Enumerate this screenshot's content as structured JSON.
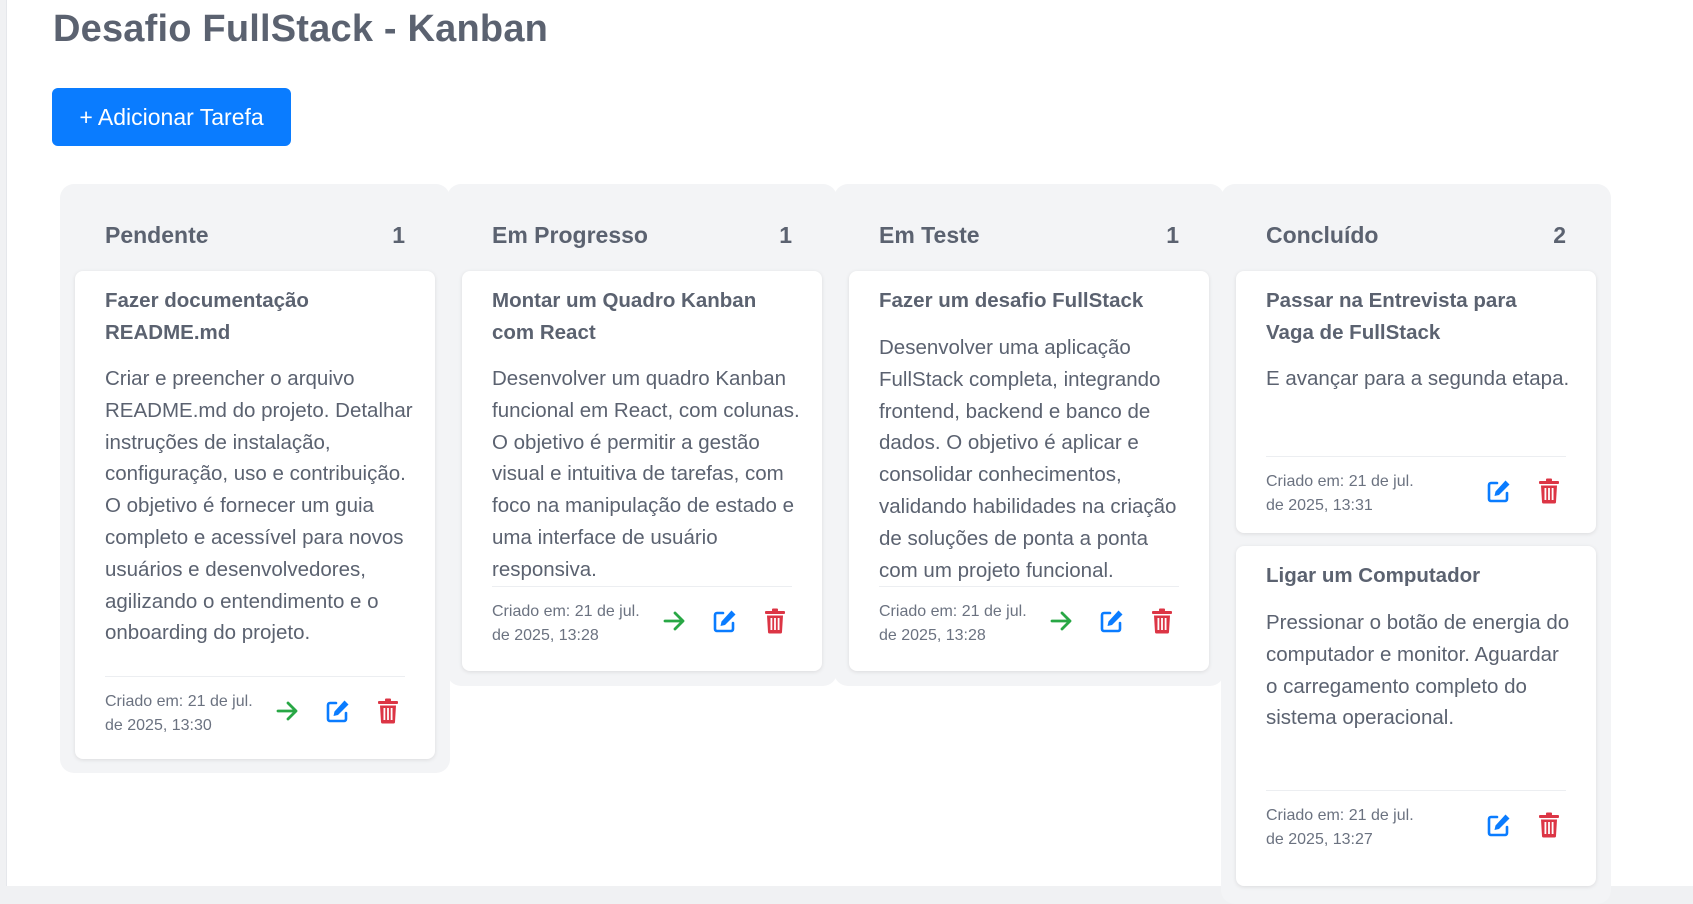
{
  "header": {
    "title": "Desafio FullStack - Kanban",
    "add_button_label": "+ Adicionar Tarefa"
  },
  "colors": {
    "primary": "#0a7cff",
    "move": "#28a745",
    "edit": "#0a7cff",
    "delete": "#dc3545"
  },
  "columns": [
    {
      "title": "Pendente",
      "count": "1",
      "cards": [
        {
          "title": "Fazer documentação README.md",
          "description": "Criar e preencher o arquivo README.md do projeto. Detalhar instruções de instalação, configuração, uso e contribuição. O objetivo é fornecer um guia completo e acessível para novos usuários e desenvolvedores, agilizando o entendimento e o onboarding do projeto.",
          "created": "Criado em: 21 de jul. de 2025, 13:30",
          "icons": [
            "arrow-right-icon",
            "edit-icon",
            "trash-icon"
          ]
        }
      ]
    },
    {
      "title": "Em Progresso",
      "count": "1",
      "cards": [
        {
          "title": "Montar um Quadro Kanban com React",
          "description": "Desenvolver um quadro Kanban funcional em React, com colunas. O objetivo é permitir a gestão visual e intuitiva de tarefas, com foco na manipulação de estado e uma interface de usuário responsiva.",
          "created": "Criado em: 21 de jul. de 2025, 13:28",
          "icons": [
            "arrow-right-icon",
            "edit-icon",
            "trash-icon"
          ]
        }
      ]
    },
    {
      "title": "Em Teste",
      "count": "1",
      "cards": [
        {
          "title": "Fazer um desafio FullStack",
          "description": "Desenvolver uma aplicação FullStack completa, integrando frontend, backend e banco de dados. O objetivo é aplicar e consolidar conhecimentos, validando habilidades na criação de soluções de ponta a ponta com um projeto funcional.",
          "created": "Criado em: 21 de jul. de 2025, 13:28",
          "icons": [
            "arrow-right-icon",
            "edit-icon",
            "trash-icon"
          ]
        }
      ]
    },
    {
      "title": "Concluído",
      "count": "2",
      "cards": [
        {
          "title": "Passar na Entrevista para Vaga de FullStack",
          "description": "E avançar para a segunda etapa.",
          "created": "Criado em: 21 de jul. de 2025, 13:31",
          "icons": [
            "edit-icon",
            "trash-icon"
          ]
        },
        {
          "title": "Ligar um Computador",
          "description": "Pressionar o botão de energia do computador e monitor. Aguardar o carregamento completo do sistema operacional.",
          "created": "Criado em: 21 de jul. de 2025, 13:27",
          "icons": [
            "edit-icon",
            "trash-icon"
          ]
        }
      ]
    }
  ]
}
